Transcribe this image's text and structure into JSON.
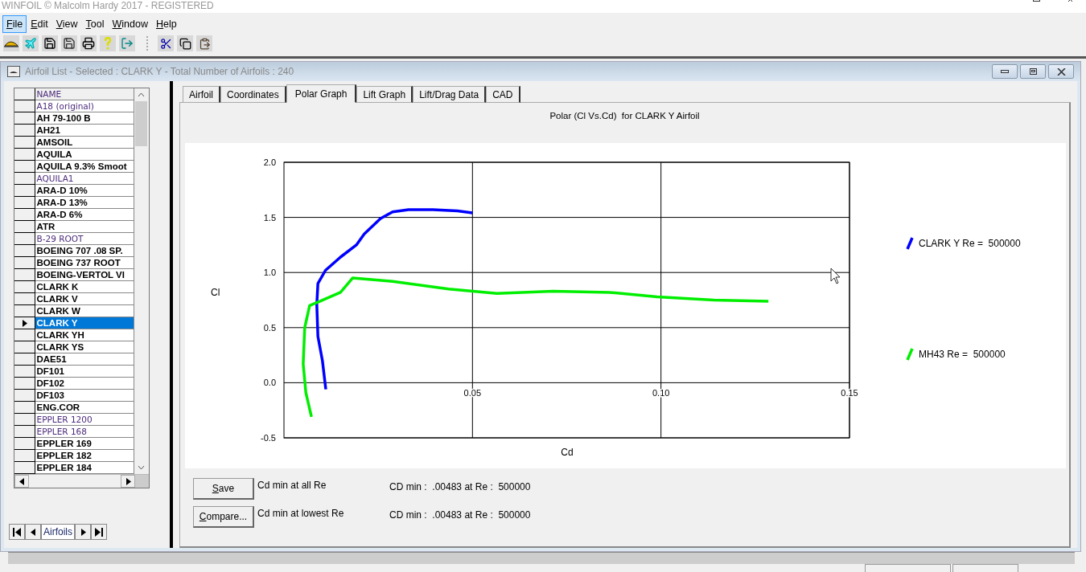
{
  "app_title": "WINFOIL © Malcolm Hardy 2017 - REGISTERED",
  "menu": [
    {
      "label": "File",
      "selected": true
    },
    {
      "label": "Edit",
      "selected": false
    },
    {
      "label": "View",
      "selected": false
    },
    {
      "label": "Tool",
      "selected": false
    },
    {
      "label": "Window",
      "selected": false
    },
    {
      "label": "Help",
      "selected": false
    }
  ],
  "child_window": {
    "title": "Airfoil List - Selected : CLARK Y - Total Number of Airfoils : 240"
  },
  "airfoil_list": {
    "header": "NAME",
    "navigator_label": "Airfoils",
    "rows": [
      {
        "name": "A18 (original)",
        "kind": "regular",
        "selected": false
      },
      {
        "name": "AH 79-100 B",
        "kind": "bold",
        "selected": false
      },
      {
        "name": "AH21",
        "kind": "bold",
        "selected": false
      },
      {
        "name": "AMSOIL",
        "kind": "bold",
        "selected": false
      },
      {
        "name": "AQUILA",
        "kind": "bold",
        "selected": false
      },
      {
        "name": "AQUILA 9.3% Smoot",
        "kind": "bold",
        "selected": false
      },
      {
        "name": "AQUILA1",
        "kind": "regular",
        "selected": false
      },
      {
        "name": "ARA-D 10%",
        "kind": "bold",
        "selected": false
      },
      {
        "name": "ARA-D 13%",
        "kind": "bold",
        "selected": false
      },
      {
        "name": "ARA-D 6%",
        "kind": "bold",
        "selected": false
      },
      {
        "name": "ATR",
        "kind": "bold",
        "selected": false
      },
      {
        "name": "B-29 ROOT",
        "kind": "regular",
        "selected": false
      },
      {
        "name": "BOEING 707 .08 SP.",
        "kind": "bold",
        "selected": false
      },
      {
        "name": "BOEING 737 ROOT",
        "kind": "bold",
        "selected": false
      },
      {
        "name": "BOEING-VERTOL VI",
        "kind": "bold",
        "selected": false
      },
      {
        "name": "CLARK K",
        "kind": "bold",
        "selected": false
      },
      {
        "name": "CLARK V",
        "kind": "bold",
        "selected": false
      },
      {
        "name": "CLARK W",
        "kind": "bold",
        "selected": false
      },
      {
        "name": "CLARK Y",
        "kind": "bold",
        "selected": true
      },
      {
        "name": "CLARK YH",
        "kind": "bold",
        "selected": false
      },
      {
        "name": "CLARK YS",
        "kind": "bold",
        "selected": false
      },
      {
        "name": "DAE51",
        "kind": "bold",
        "selected": false
      },
      {
        "name": "DF101",
        "kind": "bold",
        "selected": false
      },
      {
        "name": "DF102",
        "kind": "bold",
        "selected": false
      },
      {
        "name": "DF103",
        "kind": "bold",
        "selected": false
      },
      {
        "name": "ENG.COR",
        "kind": "bold",
        "selected": false
      },
      {
        "name": "EPPLER 1200",
        "kind": "regular",
        "selected": false
      },
      {
        "name": "EPPLER 168",
        "kind": "regular",
        "selected": false
      },
      {
        "name": "EPPLER 169",
        "kind": "bold",
        "selected": false
      },
      {
        "name": "EPPLER 182",
        "kind": "bold",
        "selected": false
      },
      {
        "name": "EPPLER 184",
        "kind": "bold",
        "selected": false
      }
    ]
  },
  "tabs": [
    {
      "label": "Airfoil",
      "selected": false
    },
    {
      "label": "Coordinates",
      "selected": false
    },
    {
      "label": "Polar Graph",
      "selected": true
    },
    {
      "label": "Lift Graph",
      "selected": false
    },
    {
      "label": "Lift/Drag Data",
      "selected": false
    },
    {
      "label": "CAD",
      "selected": false
    }
  ],
  "polar_graph": {
    "chart_data": {
      "type": "line",
      "grid": true,
      "legend": true,
      "title": "Polar (Cl Vs.Cd)  for CLARK Y Airfoil",
      "xlabel": "Cd",
      "ylabel": "Cl",
      "xlim": [
        0,
        0.15
      ],
      "ylim": [
        -0.5,
        2.0
      ],
      "xticks": [
        {
          "value": 0.05,
          "label": "0.05"
        },
        {
          "value": 0.1,
          "label": "0.10"
        },
        {
          "value": 0.15,
          "label": "0.15"
        }
      ],
      "yticks": [
        {
          "value": 2.0,
          "label": "2.0"
        },
        {
          "value": 1.5,
          "label": "1.5"
        },
        {
          "value": 1.0,
          "label": "1.0"
        },
        {
          "value": 0.5,
          "label": "0.5"
        },
        {
          "value": 0.0,
          "label": "0.0"
        },
        {
          "value": -0.5,
          "label": "-0.5"
        }
      ],
      "series": [
        {
          "name": "CLARK Y Re =  500000",
          "color": "#0000ff",
          "x": [
            0.0111,
            0.0102,
            0.009,
            0.0087,
            0.009,
            0.011,
            0.015,
            0.0192,
            0.0213,
            0.0256,
            0.0288,
            0.033,
            0.0395,
            0.046,
            0.05
          ],
          "values": [
            -0.06,
            0.2,
            0.42,
            0.71,
            0.9,
            1.02,
            1.14,
            1.25,
            1.35,
            1.49,
            1.55,
            1.57,
            1.57,
            1.56,
            1.54
          ]
        },
        {
          "name": "MH43 Re =  500000",
          "color": "#00ee00",
          "x": [
            0.0073,
            0.0058,
            0.0051,
            0.0055,
            0.0068,
            0.0096,
            0.015,
            0.0182,
            0.0288,
            0.0437,
            0.0565,
            0.0714,
            0.0863,
            0.099,
            0.114,
            0.1285
          ],
          "values": [
            -0.31,
            -0.09,
            0.17,
            0.5,
            0.7,
            0.74,
            0.82,
            0.95,
            0.92,
            0.85,
            0.81,
            0.83,
            0.82,
            0.78,
            0.75,
            0.74
          ]
        }
      ]
    }
  },
  "actions": [
    {
      "button": "Save",
      "caption": "Cd min at all Re",
      "result": "CD min :  .00483 at Re :  500000"
    },
    {
      "button": "Compare...",
      "caption": "Cd min at lowest Re",
      "result": "CD min :  .00483 at Re :  500000"
    }
  ]
}
